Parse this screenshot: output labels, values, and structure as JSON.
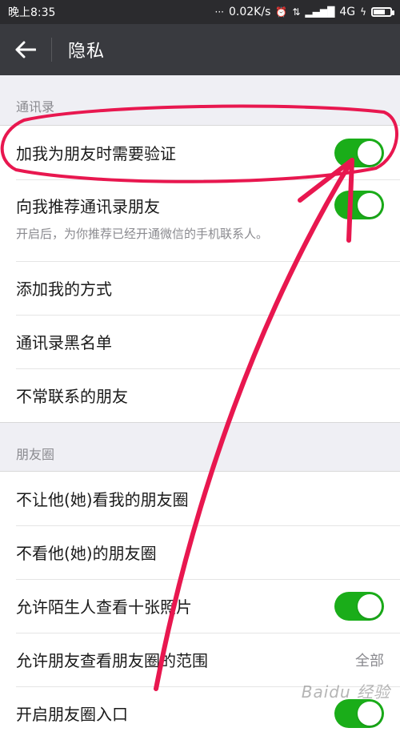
{
  "status_bar": {
    "time": "晚上8:35",
    "speed": "0.02K/s",
    "network": "4G"
  },
  "header": {
    "title": "隐私"
  },
  "sections": [
    {
      "header": "通讯录",
      "items": [
        {
          "label": "加我为朋友时需要验证",
          "toggle": true
        },
        {
          "label": "向我推荐通讯录朋友",
          "sub": "开启后，为你推荐已经开通微信的手机联系人。",
          "toggle": true
        },
        {
          "label": "添加我的方式"
        },
        {
          "label": "通讯录黑名单"
        },
        {
          "label": "不常联系的朋友"
        }
      ]
    },
    {
      "header": "朋友圈",
      "items": [
        {
          "label": "不让他(她)看我的朋友圈"
        },
        {
          "label": "不看他(她)的朋友圈"
        },
        {
          "label": "允许陌生人查看十张照片",
          "toggle": true
        },
        {
          "label": "允许朋友查看朋友圈的范围",
          "value": "全部"
        },
        {
          "label": "开启朋友圈入口",
          "toggle": true
        }
      ]
    }
  ],
  "watermark": "Baidu 经验",
  "colors": {
    "toggle_on": "#1aad19",
    "title_bar": "#393a3f",
    "annotation": "#e8174f"
  }
}
